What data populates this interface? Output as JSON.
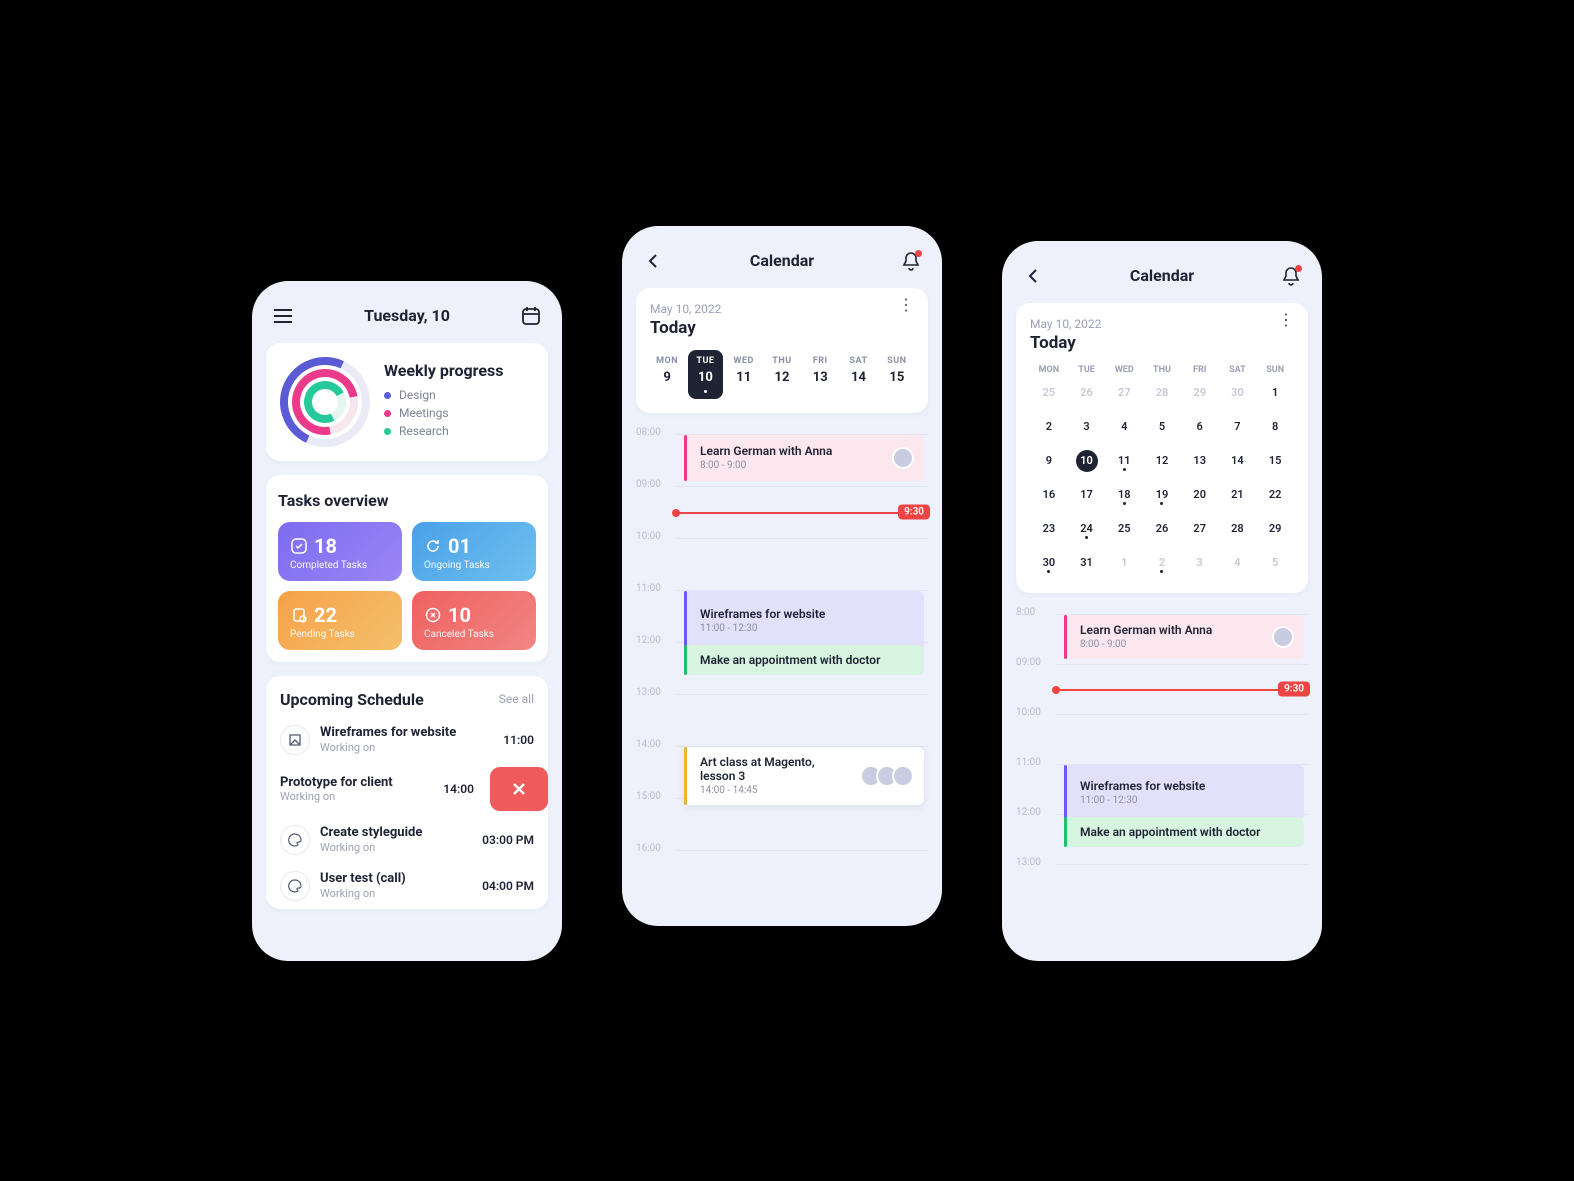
{
  "colors": {
    "indigo": "#5b5bd6",
    "pink": "#ec3a8b",
    "teal": "#26c99a"
  },
  "screen1": {
    "header_title": "Tuesday, 10",
    "progress": {
      "title": "Weekly progress",
      "legend": [
        {
          "label": "Design",
          "color": "#5b5bd6"
        },
        {
          "label": "Meetings",
          "color": "#ec3a8b"
        },
        {
          "label": "Research",
          "color": "#26c99a"
        }
      ]
    },
    "tasks_overview": {
      "title": "Tasks overview",
      "tiles": [
        {
          "value": "18",
          "label": "Completed Tasks",
          "icon": "check"
        },
        {
          "value": "01",
          "label": "Ongoing Tasks",
          "icon": "refresh"
        },
        {
          "value": "22",
          "label": "Pending Tasks",
          "icon": "clipboard"
        },
        {
          "value": "10",
          "label": "Canceled Tasks",
          "icon": "cancel"
        }
      ]
    },
    "upcoming": {
      "title": "Upcoming Schedule",
      "see_all": "See all",
      "items": [
        {
          "title": "Wireframes for website",
          "status": "Working on",
          "time": "11:00"
        },
        {
          "title": "Prototype for client",
          "status": "Working on",
          "time": "14:00",
          "swiped": true
        },
        {
          "title": "Create styleguide",
          "status": "Working on",
          "time": "03:00 PM"
        },
        {
          "title": "User test (call)",
          "status": "Working on",
          "time": "04:00 PM"
        }
      ]
    }
  },
  "screen2": {
    "header_title": "Calendar",
    "date_label": "May 10, 2022",
    "today_label": "Today",
    "week": [
      {
        "dow": "MON",
        "day": "9"
      },
      {
        "dow": "TUE",
        "day": "10",
        "selected": true
      },
      {
        "dow": "WED",
        "day": "11"
      },
      {
        "dow": "THU",
        "day": "12"
      },
      {
        "dow": "FRI",
        "day": "13"
      },
      {
        "dow": "SAT",
        "day": "14"
      },
      {
        "dow": "SUN",
        "day": "15"
      }
    ],
    "now_time": "9:30",
    "hours": [
      "08:00",
      "09:00",
      "10:00",
      "11:00",
      "12:00",
      "13:00",
      "14:00",
      "15:00",
      "16:00"
    ],
    "events": [
      {
        "title": "Learn German with Anna",
        "time": "8:00 - 9:00",
        "color": "pink",
        "avatars": 1
      },
      {
        "title": "Wireframes for website",
        "time": "11:00 - 12:30",
        "color": "purple"
      },
      {
        "title": "Make an appointment with doctor",
        "time": "",
        "color": "green"
      },
      {
        "title": "Art class at Magento, lesson 3",
        "time": "14:00 - 14:45",
        "color": "white",
        "avatars": 3
      }
    ]
  },
  "screen3": {
    "header_title": "Calendar",
    "date_label": "May 10, 2022",
    "today_label": "Today",
    "dow": [
      "MON",
      "TUE",
      "WED",
      "THU",
      "FRI",
      "SAT",
      "SUN"
    ],
    "month_cells": [
      {
        "n": "25",
        "out": true
      },
      {
        "n": "26",
        "out": true
      },
      {
        "n": "27",
        "out": true
      },
      {
        "n": "28",
        "out": true
      },
      {
        "n": "29",
        "out": true
      },
      {
        "n": "30",
        "out": true
      },
      {
        "n": "1"
      },
      {
        "n": "2"
      },
      {
        "n": "3"
      },
      {
        "n": "4"
      },
      {
        "n": "5"
      },
      {
        "n": "6"
      },
      {
        "n": "7"
      },
      {
        "n": "8"
      },
      {
        "n": "9"
      },
      {
        "n": "10",
        "sel": true
      },
      {
        "n": "11",
        "has": true
      },
      {
        "n": "12"
      },
      {
        "n": "13"
      },
      {
        "n": "14"
      },
      {
        "n": "15"
      },
      {
        "n": "16"
      },
      {
        "n": "17"
      },
      {
        "n": "18",
        "has": true
      },
      {
        "n": "19",
        "has": true
      },
      {
        "n": "20"
      },
      {
        "n": "21"
      },
      {
        "n": "22"
      },
      {
        "n": "23"
      },
      {
        "n": "24",
        "has": true
      },
      {
        "n": "25"
      },
      {
        "n": "26"
      },
      {
        "n": "27"
      },
      {
        "n": "28"
      },
      {
        "n": "29"
      },
      {
        "n": "30",
        "has": true
      },
      {
        "n": "31"
      },
      {
        "n": "1",
        "out": true
      },
      {
        "n": "2",
        "out": true,
        "has": true
      },
      {
        "n": "3",
        "out": true
      },
      {
        "n": "4",
        "out": true
      },
      {
        "n": "5",
        "out": true
      }
    ],
    "now_time": "9:30",
    "hours": [
      "8:00",
      "09:00",
      "10:00",
      "11:00",
      "12:00",
      "13:00"
    ],
    "events": [
      {
        "title": "Learn German with Anna",
        "time": "8:00 - 9:00",
        "color": "pink",
        "avatars": 1
      },
      {
        "title": "Wireframes for website",
        "time": "11:00 - 12:30",
        "color": "purple"
      },
      {
        "title": "Make an appointment with doctor",
        "time": "",
        "color": "green"
      }
    ]
  }
}
